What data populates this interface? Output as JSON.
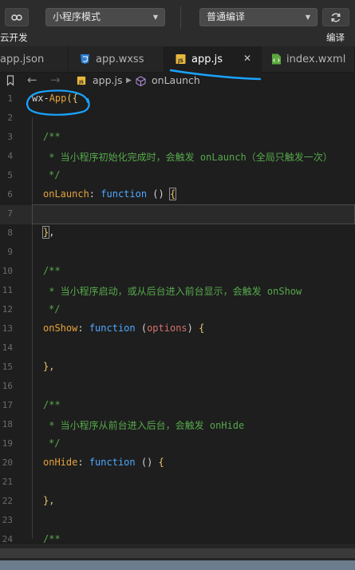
{
  "toolbar": {
    "mode_select": "小程序模式",
    "compile_select": "普通编译",
    "left_label": "云开发",
    "right_label": "编译"
  },
  "tabs": [
    {
      "label": "app.json",
      "icon": "json-file-icon"
    },
    {
      "label": "app.wxss",
      "icon": "css-file-icon"
    },
    {
      "label": "app.js",
      "icon": "js-file-icon",
      "active": true
    },
    {
      "label": "index.wxml",
      "icon": "wxml-file-icon"
    }
  ],
  "breadcrumb": {
    "file": "app.js",
    "symbol": "onLaunch"
  },
  "editor": {
    "line_numbers": [
      "1",
      "2",
      "3",
      "4",
      "5",
      "6",
      "7",
      "8",
      "9",
      "10",
      "11",
      "12",
      "13",
      "14",
      "15",
      "16",
      "17",
      "18",
      "19",
      "20",
      "21",
      "22",
      "23",
      "24"
    ],
    "code": {
      "l1_a": "wx-",
      "l1_b": "App",
      "l1_c": "({",
      "c_open": "/**",
      "c_close": "*/",
      "c4": " * 当小程序初始化完成时，会触发 onLaunch（全局只触发一次）",
      "c11": " * 当小程序启动，或从后台进入前台显示，会触发 onShow",
      "c19": " * 当小程序从前台进入后台，会触发 onHide",
      "onlaunch": "onLaunch",
      "onshow": "onShow",
      "onhide": "onHide",
      "colon": ":",
      "function_kw": "function",
      "empty_params": " () ",
      "options_open": " (",
      "options": "options",
      "options_close": ") ",
      "brace_open": "{",
      "brace_close": "}",
      "brace_close_comma": "},",
      "comma": ","
    }
  },
  "colors": {
    "keyword": "#4ea9ff",
    "property": "#e6a33c",
    "comment": "#56a84b",
    "param": "#d86f6f",
    "annotation": "#1aa3ff"
  }
}
